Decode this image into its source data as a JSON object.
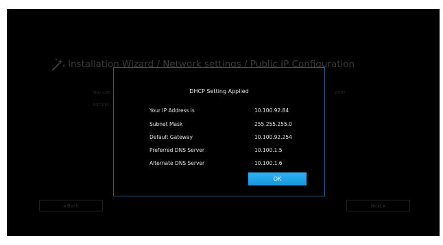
{
  "wizard": {
    "title": "Installation Wizard / Network settings / Public IP Configuration",
    "bg_line_1_left": "You can",
    "bg_line_1_right": "your",
    "bg_line_2_left": "admini",
    "back_label": "◂ Back",
    "next_label": "Next ▸"
  },
  "dialog": {
    "title": "DHCP Setting Applied",
    "rows": [
      {
        "label": "Your IP Address is",
        "value": "10.100.92.84"
      },
      {
        "label": "Subnet Mask",
        "value": "255.255.255.0"
      },
      {
        "label": "Default Gateway",
        "value": "10.100.92.254"
      },
      {
        "label": "Preferred DNS Server",
        "value": "10.100.1.5"
      },
      {
        "label": "Alternate DNS Server",
        "value": "10.100.1.6"
      }
    ],
    "ok_label": "OK"
  },
  "colors": {
    "background": "#000000",
    "dialog_border": "#1d5f8c",
    "ok_button": "#1fa6ea",
    "dim_text": "#3a3a3a"
  },
  "icons": {
    "wizard": "magic-wand-icon"
  }
}
